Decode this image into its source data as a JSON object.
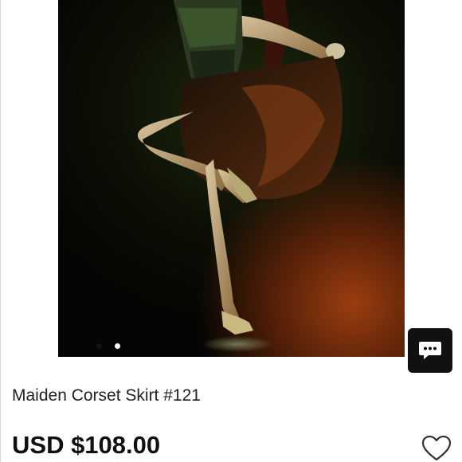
{
  "product": {
    "title": "Maiden Corset Skirt #121",
    "price": "USD $108.00",
    "image_description_icon": "dancer-photo"
  },
  "gallery": {
    "dot_count": 2,
    "active_index": 0
  },
  "icons": {
    "chat": "chat-bubble-ellipsis-icon",
    "like": "heart-outline-icon"
  },
  "colors": {
    "chat_button_bg": "#111111",
    "price_text": "#111111",
    "title_text": "#222222"
  }
}
